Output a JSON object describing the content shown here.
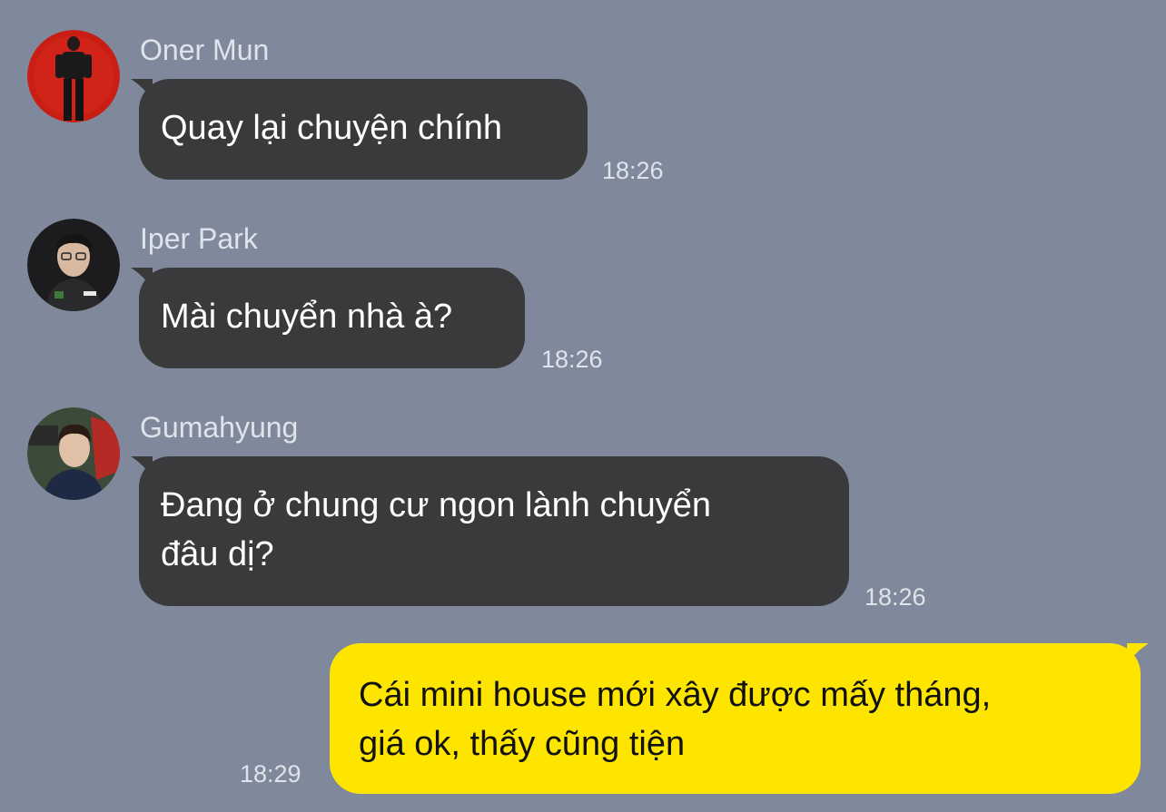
{
  "colors": {
    "background": "#7f899b",
    "incoming_bubble": "#3a3a3c",
    "outgoing_bubble": "#fee500",
    "meta_text": "#dfe3ea"
  },
  "messages": [
    {
      "sender": "Oner Mun",
      "avatar": "oner-mun-avatar",
      "text": "Quay lại chuyện chính",
      "time": "18:26"
    },
    {
      "sender": "Iper Park",
      "avatar": "iper-park-avatar",
      "text": "Mài chuyển nhà à?",
      "time": "18:26"
    },
    {
      "sender": "Gumahyung",
      "avatar": "gumahyung-avatar",
      "text_lines": [
        "Đang ở chung cư ngon lành chuyển",
        "đâu dị?"
      ],
      "time": "18:26"
    }
  ],
  "my_message": {
    "text_lines": [
      "Cái mini house mới xây được mấy tháng,",
      "giá ok, thấy cũng tiện"
    ],
    "time": "18:29"
  }
}
